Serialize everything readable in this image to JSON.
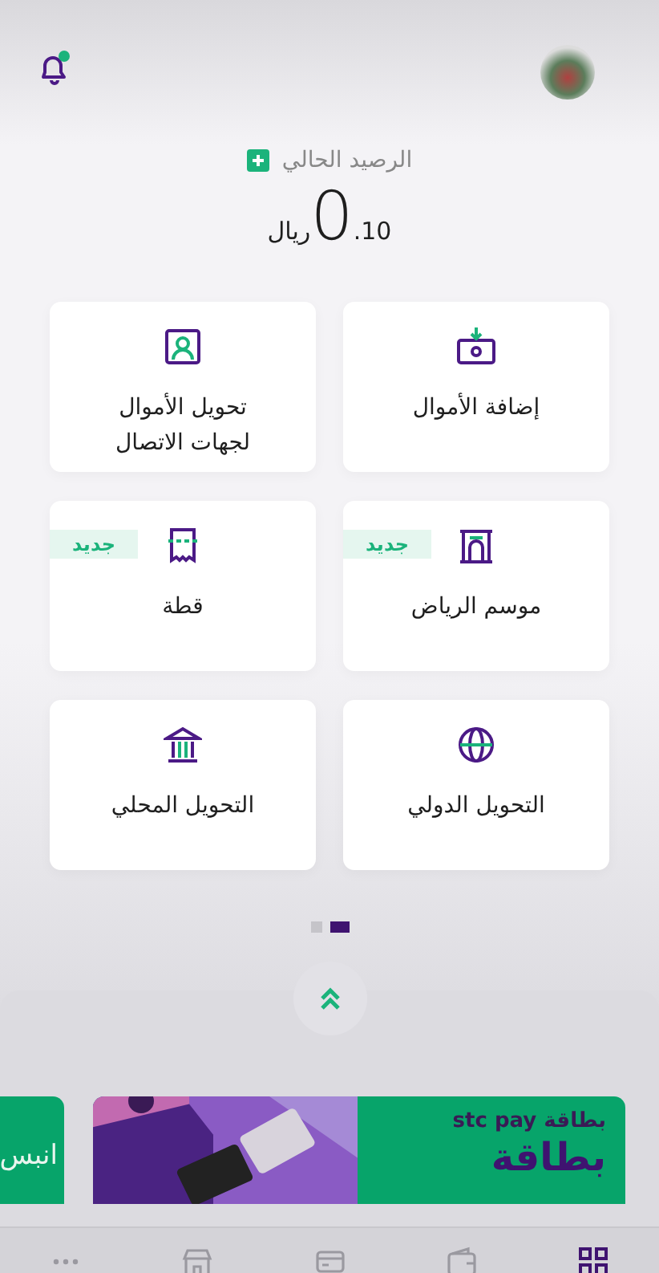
{
  "balance": {
    "label": "الرصيد الحالي",
    "integer": "0",
    "decimals": ".10",
    "currency": "ريال"
  },
  "services": [
    {
      "label": "إضافة الأموال"
    },
    {
      "label": "تحويل الأموال لجهات الاتصال"
    },
    {
      "label": "موسم الرياض",
      "badge": "جديد"
    },
    {
      "label": "قطة",
      "badge": "جديد"
    },
    {
      "label": "التحويل الدولي"
    },
    {
      "label": "التحويل المحلي"
    }
  ],
  "pager": [
    {
      "selected": true
    },
    {
      "selected": false
    }
  ],
  "banners": [
    {
      "kicker": "بطاقة stc pay",
      "headline": "بطاقة"
    },
    {
      "headline": "انبس"
    }
  ],
  "nav": [
    {
      "selected": true
    },
    {
      "selected": false
    },
    {
      "selected": false
    },
    {
      "selected": false
    },
    {
      "selected": false
    }
  ]
}
